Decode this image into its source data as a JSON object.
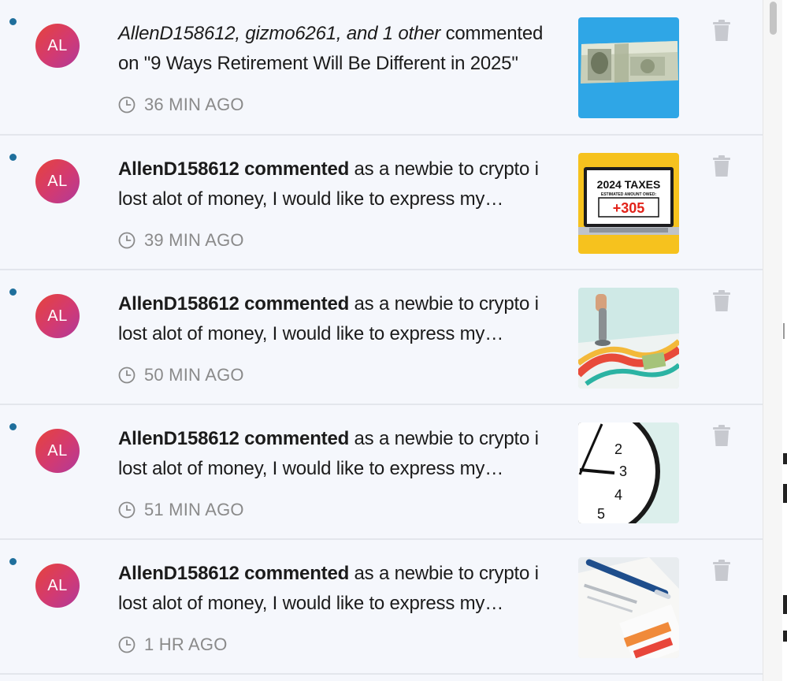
{
  "notifications": [
    {
      "avatar_initials": "AL",
      "actors": "AllenD158612, gizmo6261, and 1 other",
      "action": "commented",
      "detail": "on \"9 Ways Retirement Will Be Different in 2025\"",
      "time": "36 MIN AGO",
      "thumbnail": "dollar-bill-thumbnail"
    },
    {
      "avatar_initials": "AL",
      "actors": "AllenD158612 commented",
      "detail": "as a newbie to crypto i lost alot of money, I would like to express my…",
      "time": "39 MIN AGO",
      "thumbnail": "taxes-laptop-thumbnail",
      "thumb_text_title": "2024 TAXES",
      "thumb_text_sub": "ESTIMATED AMOUNT OWED:",
      "thumb_text_value": "+305"
    },
    {
      "avatar_initials": "AL",
      "actors": "AllenD158612 commented",
      "detail": "as a newbie to crypto i lost alot of money, I would like to express my…",
      "time": "50 MIN AGO",
      "thumbnail": "board-game-thumbnail"
    },
    {
      "avatar_initials": "AL",
      "actors": "AllenD158612 commented",
      "detail": "as a newbie to crypto i lost alot of money, I would like to express my…",
      "time": "51 MIN AGO",
      "thumbnail": "clock-thumbnail",
      "clock_numbers": [
        "2",
        "3",
        "4",
        "5"
      ]
    },
    {
      "avatar_initials": "AL",
      "actors": "AllenD158612 commented",
      "detail": "as a newbie to crypto i lost alot of money, I would like to express my…",
      "time": "1 HR AGO",
      "thumbnail": "documents-pen-thumbnail"
    }
  ],
  "icons": {
    "unread": "unread-dot",
    "time": "clock-icon",
    "delete": "trash-icon"
  },
  "colors": {
    "unread_dot": "#1f6f9c",
    "avatar_gradient": [
      "#e7433a",
      "#b0399a"
    ],
    "time_text": "#8a8a8a",
    "panel_bg": "#f5f7fc"
  }
}
